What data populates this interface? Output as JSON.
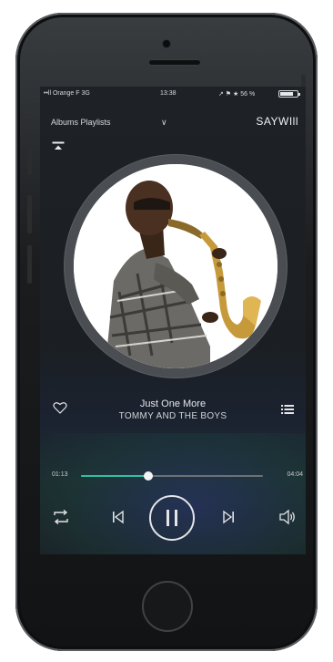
{
  "status_bar": {
    "carrier": "••ll Orange F 3G",
    "time": "13:38",
    "battery_text": "↗ ⚑ ★ 56 %",
    "battery_level": 0.75
  },
  "header": {
    "playlist_label": "Albums Playlists",
    "device_label": "SAYWIll"
  },
  "now_playing": {
    "title": "Just One More",
    "artist": "TOMMY AND THE BOYS",
    "elapsed": "01:13",
    "total": "04:04",
    "progress": 0.37,
    "state": "playing"
  },
  "icons": {
    "minimize": "minimize-icon",
    "heart": "heart-icon",
    "list": "list-icon",
    "repeat": "repeat-icon",
    "previous": "previous-icon",
    "pause": "pause-icon",
    "next": "next-icon",
    "volume": "volume-icon"
  },
  "colors": {
    "accent": "#2fc0a4",
    "screen_bg": "#1e2226",
    "phone_body": "#1a1c1e"
  }
}
